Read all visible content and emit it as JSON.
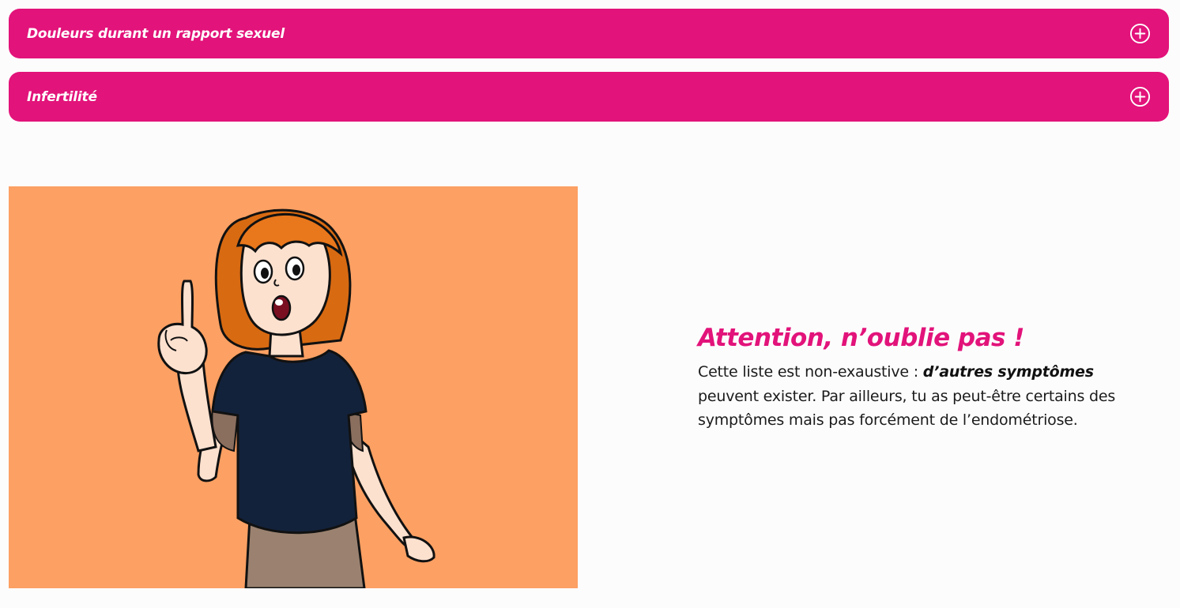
{
  "accordion": [
    {
      "title": "Douleurs durant un rapport sexuel",
      "icon": "plus-circle-icon"
    },
    {
      "title": "Infertilité",
      "icon": "plus-circle-icon"
    }
  ],
  "callout": {
    "title": "Attention, n’oublie pas !",
    "text_before": "Cette liste est non-exaustive : ",
    "text_emphasis": "d’autres symptômes",
    "text_after": " peuvent exister. Par ailleurs, tu as peut-être certains des symptômes mais pas forcément de l’endométriose."
  },
  "colors": {
    "accent": "#e2137a",
    "illustration_bg": "#fca063"
  }
}
